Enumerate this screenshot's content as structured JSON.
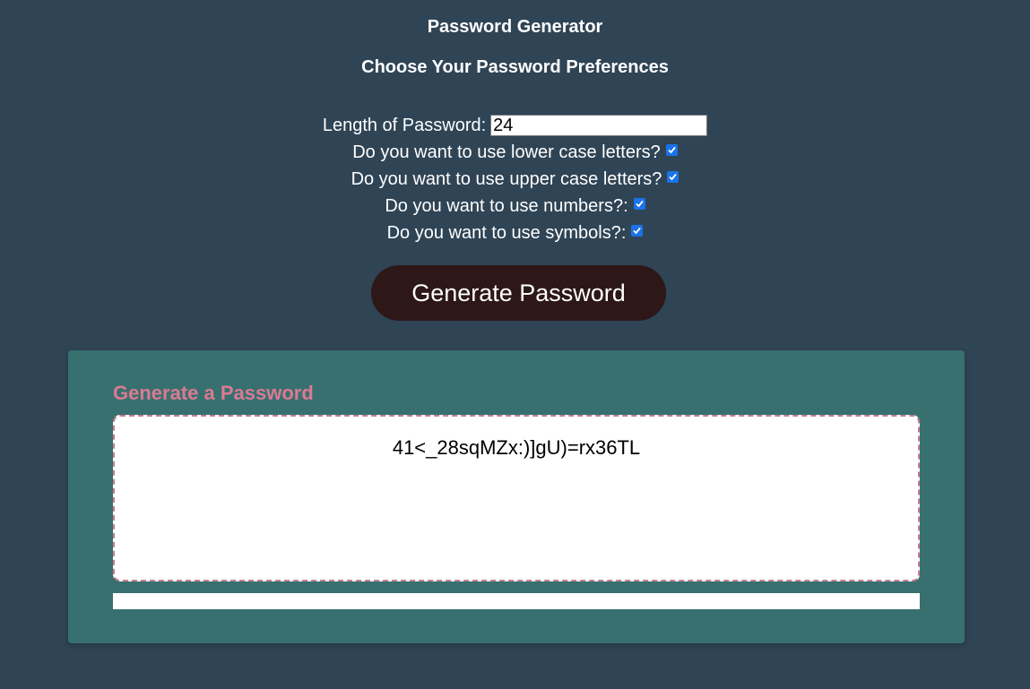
{
  "header": {
    "title": "Password Generator",
    "subtitle": "Choose Your Password Preferences"
  },
  "preferences": {
    "length_label": "Length of Password:",
    "length_value": "24",
    "lowercase_label": "Do you want to use lower case letters?",
    "lowercase_checked": true,
    "uppercase_label": "Do you want to use upper case letters?",
    "uppercase_checked": true,
    "numbers_label": "Do you want to use numbers?:",
    "numbers_checked": true,
    "symbols_label": "Do you want to use symbols?:",
    "symbols_checked": true
  },
  "actions": {
    "generate_label": "Generate Password"
  },
  "card": {
    "header": "Generate a Password",
    "password": "41<_28sqMZx:)]gU)=rx36TL"
  },
  "colors": {
    "background": "#2f4455",
    "button": "#2d1717",
    "card": "#37706f",
    "card_header": "#db7a93",
    "checkbox": "#1a73e8"
  }
}
